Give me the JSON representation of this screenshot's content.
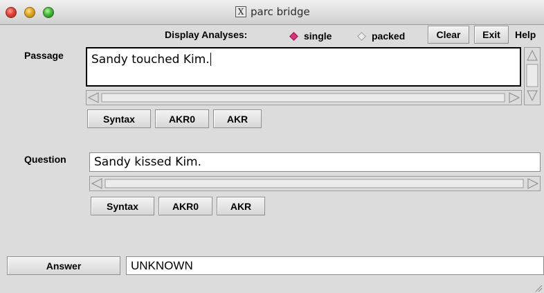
{
  "window": {
    "title": "parc bridge",
    "title_icon_glyph": "X"
  },
  "toolbar": {
    "display_label": "Display Analyses:",
    "radio_single": "single",
    "radio_packed": "packed",
    "selected": "single",
    "clear": "Clear",
    "exit": "Exit",
    "help": "Help"
  },
  "passage": {
    "label": "Passage",
    "value": "Sandy touched Kim.",
    "buttons": [
      "Syntax",
      "AKR0",
      "AKR"
    ]
  },
  "question": {
    "label": "Question",
    "value": "Sandy kissed Kim.",
    "buttons": [
      "Syntax",
      "AKR0",
      "AKR"
    ]
  },
  "answer": {
    "button": "Answer",
    "value": "UNKNOWN"
  },
  "colors": {
    "selected_radio": "#d7327a",
    "window_bg": "#dcdcdc"
  },
  "icons": [
    "close-button-icon",
    "minimize-button-icon",
    "zoom-button-icon",
    "x11-icon",
    "scroll-left-arrow-icon",
    "scroll-right-arrow-icon",
    "scroll-up-arrow-icon",
    "scroll-down-arrow-icon",
    "resize-grip-icon"
  ]
}
